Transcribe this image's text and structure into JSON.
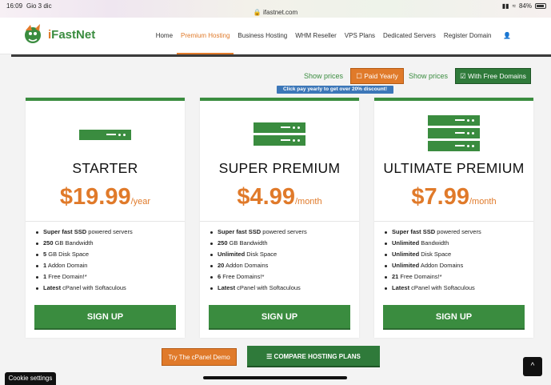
{
  "status_bar": {
    "time": "16:09",
    "date": "Gio 3 dic",
    "url": "ifastnet.com",
    "battery": "84%"
  },
  "logo": {
    "brand_prefix": "i",
    "brand_rest": "FastNet"
  },
  "nav": {
    "items": [
      "Home",
      "Premium Hosting",
      "Business Hosting",
      "WHM Reseller",
      "VPS Plans",
      "Dedicated Servers",
      "Register Domain",
      "Login"
    ],
    "active": "Premium Hosting"
  },
  "pricing_toggle": {
    "show_prices_1": "Show prices",
    "paid_yearly": "Paid Yearly",
    "show_prices_2": "Show prices",
    "free_domains": "With Free Domains",
    "discount_note": "Click pay yearly to get over 20% discount!"
  },
  "plans": [
    {
      "name": "STARTER",
      "price": "$19.99",
      "period": "/year",
      "server_units": 1,
      "features": [
        {
          "bold": "Super fast SSD",
          "rest": " powered servers"
        },
        {
          "bold": "250",
          "rest": " GB Bandwidth"
        },
        {
          "bold": "5",
          "rest": " GB Disk Space"
        },
        {
          "bold": "1",
          "rest": " Addon Domain"
        },
        {
          "bold": "1",
          "rest": " Free Domain!*"
        },
        {
          "bold": "Latest",
          "rest": " cPanel with Softaculous"
        }
      ],
      "cta": "SIGN UP"
    },
    {
      "name": "SUPER PREMIUM",
      "price": "$4.99",
      "period": "/month",
      "server_units": 2,
      "features": [
        {
          "bold": "Super fast SSD",
          "rest": " powered servers"
        },
        {
          "bold": "250",
          "rest": " GB Bandwidth"
        },
        {
          "bold": "Unlimited",
          "rest": " Disk Space"
        },
        {
          "bold": "20",
          "rest": " Addon Domains"
        },
        {
          "bold": "6",
          "rest": " Free Domains!*"
        },
        {
          "bold": "Latest",
          "rest": " cPanel with Softaculous"
        }
      ],
      "cta": "SIGN UP"
    },
    {
      "name": "ULTIMATE PREMIUM",
      "price": "$7.99",
      "period": "/month",
      "server_units": 3,
      "features": [
        {
          "bold": "Super fast SSD",
          "rest": " powered servers"
        },
        {
          "bold": "Unlimited",
          "rest": " Bandwidth"
        },
        {
          "bold": "Unlimited",
          "rest": " Disk Space"
        },
        {
          "bold": "Unlimited",
          "rest": " Addon Domains"
        },
        {
          "bold": "21",
          "rest": " Free Domains!*"
        },
        {
          "bold": "Latest",
          "rest": " cPanel with Softaculous"
        }
      ],
      "cta": "SIGN UP"
    }
  ],
  "bottom": {
    "try_demo": "Try The cPanel Demo",
    "compare": "COMPARE HOSTING PLANS",
    "cookie": "Cookie settings",
    "scroll_top": "^"
  },
  "colors": {
    "brand_green": "#3a8c3f",
    "brand_orange": "#e07a2a",
    "info_blue": "#3c77b8"
  }
}
